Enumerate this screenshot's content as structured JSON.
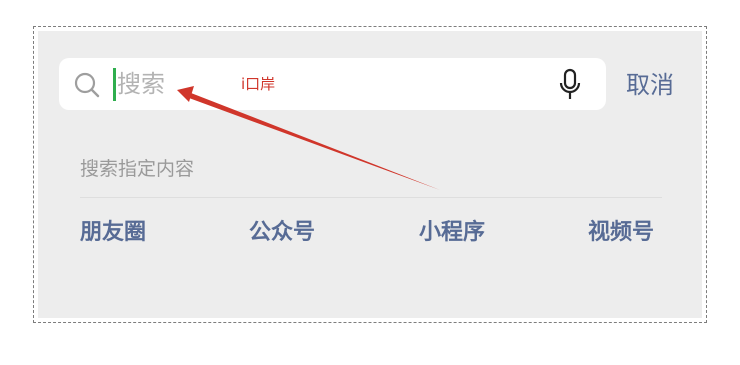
{
  "search": {
    "placeholder": "搜索",
    "annotation": "i口岸",
    "cancel_label": "取消"
  },
  "section": {
    "title": "搜索指定内容",
    "categories": [
      "朋友圈",
      "公众号",
      "小程序",
      "视频号"
    ]
  },
  "icons": {
    "search": "search-icon",
    "mic": "microphone-icon"
  },
  "colors": {
    "accent_link": "#576b95",
    "annotation_red": "#d0362b",
    "caret_green": "#2fae4e",
    "panel_bg": "#ededed"
  }
}
